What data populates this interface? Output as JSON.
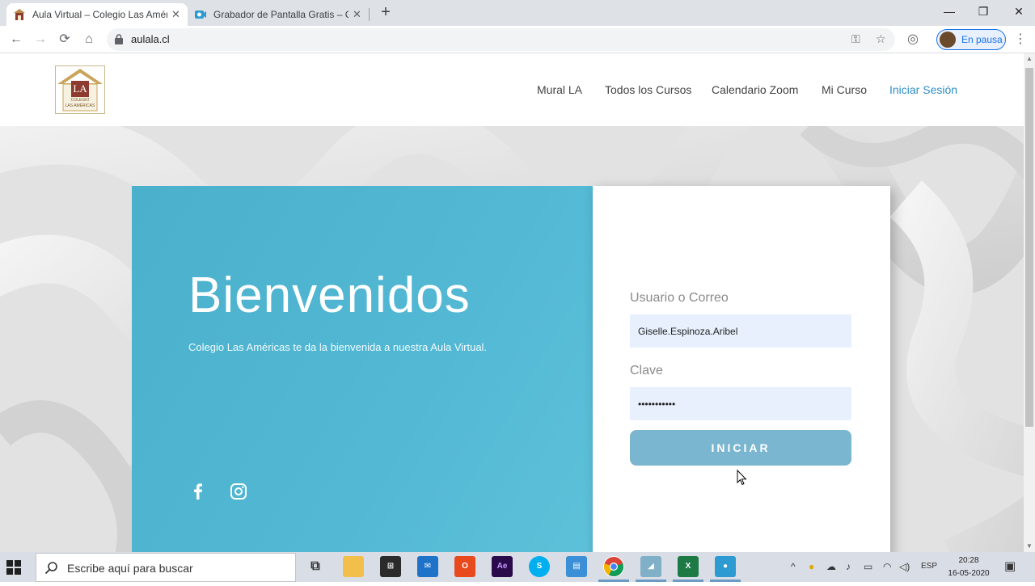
{
  "browser": {
    "tabs": [
      {
        "title": "Aula Virtual – Colegio Las Américas",
        "active": true
      },
      {
        "title": "Grabador de Pantalla Gratis – Captura de pantalla",
        "active": false
      }
    ],
    "url": "aulala.cl",
    "profile_label": "En pausa",
    "new_tab_symbol": "+"
  },
  "site": {
    "logo_initials": "LA",
    "logo_line1": "COLEGIO",
    "logo_line2": "LAS AMÉRICAS",
    "nav": [
      {
        "label": "Mural LA"
      },
      {
        "label": "Todos los Cursos"
      },
      {
        "label": "Calendario Zoom"
      },
      {
        "label": "Mi Curso"
      },
      {
        "label": "Iniciar Sesión",
        "active": true
      }
    ],
    "accent_color": "#2f8fc7",
    "panel_color": "#4fb5d0"
  },
  "welcome": {
    "title": "Bienvenidos",
    "subtitle": "Colegio Las Américas te da la bienvenida a nuestra Aula Virtual."
  },
  "login": {
    "user_label": "Usuario o Correo",
    "user_value": "Giselle.Espinoza.Aribel",
    "password_label": "Clave",
    "password_value": "•••••••••••",
    "submit_label": "INICIAR"
  },
  "taskbar": {
    "search_placeholder": "Escribe aquí para buscar",
    "language": "ESP",
    "time": "20:28",
    "date": "16-05-2020"
  }
}
